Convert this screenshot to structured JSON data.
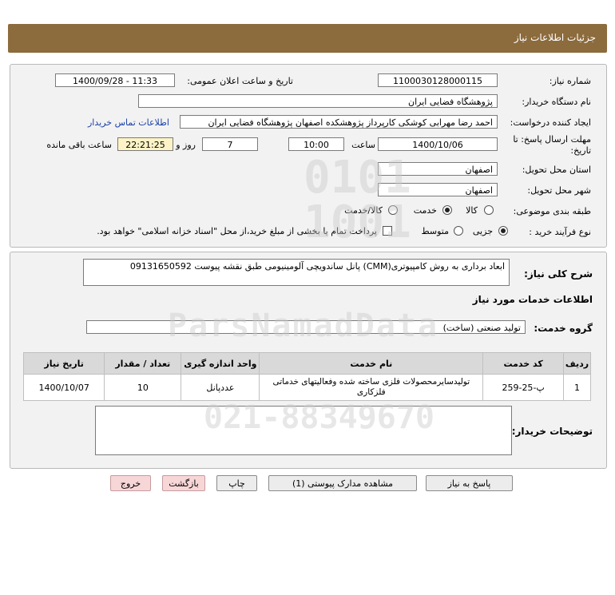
{
  "header": {
    "title": "جزئیات اطلاعات نیاز"
  },
  "form": {
    "need_number_label": "شماره نیاز:",
    "need_number": "1100030128000115",
    "announce_label": "تاریخ و ساعت اعلان عمومی:",
    "announce_value": "1400/09/28 - 11:33",
    "buyer_label": "نام دستگاه خریدار:",
    "buyer_value": "پژوهشگاه فضایی ایران",
    "creator_label": "ایجاد کننده درخواست:",
    "creator_value": "احمد رضا مهرابی کوشکی کارپرداز پژوهشکده اصفهان پژوهشگاه فضایی ایران",
    "contact_link": "اطلاعات تماس خریدار",
    "deadline_label_1": "مهلت ارسال پاسخ: تا",
    "deadline_label_2": "تاریخ:",
    "deadline_date": "1400/10/06",
    "time_label": "ساعت",
    "deadline_time": "10:00",
    "days_value": "7",
    "days_label": "روز و",
    "remaining_time": "22:21:25",
    "remaining_label": "ساعت باقی مانده",
    "province_label": "استان محل تحویل:",
    "province_value": "اصفهان",
    "city_label": "شهر محل تحویل:",
    "city_value": "اصفهان",
    "category_label": "طبقه بندی موضوعی:",
    "category_options": [
      "کالا",
      "خدمت",
      "کالا/خدمت"
    ],
    "category_selected": "خدمت",
    "process_label": "نوع فرآیند خرید :",
    "process_options": [
      "جزیی",
      "متوسط"
    ],
    "process_selected": "جزیی",
    "payment_note": "پرداخت تمام یا بخشی از مبلغ خرید،از محل \"اسناد خزانه اسلامی\" خواهد بود."
  },
  "details": {
    "summary_label": "شرح کلی نیاز:",
    "summary_value": "ابعاد برداری به روش کامپیوتری(CMM) پانل ساندویچی آلومینیومی طبق نقشه پیوست 09131650592",
    "services_heading": "اطلاعات خدمات مورد نیاز",
    "service_group_label": "گروه خدمت:",
    "service_group_value": "تولید صنعتی (ساخت)",
    "table": {
      "headers": [
        "ردیف",
        "کد خدمت",
        "نام خدمت",
        "واحد اندازه گیری",
        "تعداد / مقدار",
        "تاریخ نیاز"
      ],
      "rows": [
        [
          "1",
          "پ-25-259",
          "تولیدسایرمحصولات فلزی ساخته شده وفعالیتهای خدماتی فلزکاری",
          "عددپانل",
          "10",
          "1400/10/07"
        ]
      ]
    },
    "buyer_notes_label": "توضیحات خریدار:",
    "buyer_notes_value": ""
  },
  "buttons": {
    "reply": "پاسخ به نیاز",
    "attachments": "مشاهده مدارک پیوستی (1)",
    "print": "چاپ",
    "back": "بازگشت",
    "exit": "خروج"
  }
}
